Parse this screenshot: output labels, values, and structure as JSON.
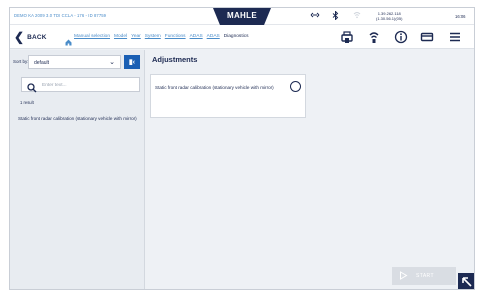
{
  "statusbar": {
    "vehicle": "DEMO KA 2009 3.0 TDI CCLA - 176 - ID 87759",
    "brand": "MAHLE",
    "odometer_line1": "1.39.262.118",
    "odometer_line2": "(1.30.56.1)(05)",
    "time": "16:06",
    "icons": [
      "signal-icon",
      "bluetooth-icon",
      "wifi-icon"
    ]
  },
  "nav": {
    "back_label": "BACK",
    "breadcrumbs": [
      "Manual selection",
      "Model",
      "Year",
      "System",
      "Functions",
      "ADAS",
      "ADAS",
      "Diagnostics"
    ],
    "right_icons": [
      "vehicle-interface-icon",
      "connection-icon",
      "info-icon",
      "tray-icon",
      "menu-icon"
    ]
  },
  "left": {
    "sort_label": "Sort by:",
    "sort_value": "default",
    "search_placeholder": "Enter text...",
    "result_count": "1 result",
    "results": [
      "Static front radar calibration (stationary vehicle with mirror)"
    ]
  },
  "main": {
    "title": "Adjustments",
    "cards": [
      {
        "label": "Static front radar calibration (stationary vehicle with mirror)",
        "selected": false
      }
    ],
    "start_label": "START"
  },
  "colors": {
    "brand_navy": "#1d2a52",
    "link_blue": "#4a8cc9",
    "accent_blue": "#1a5fb4",
    "disabled_grey": "#d9dde3"
  }
}
